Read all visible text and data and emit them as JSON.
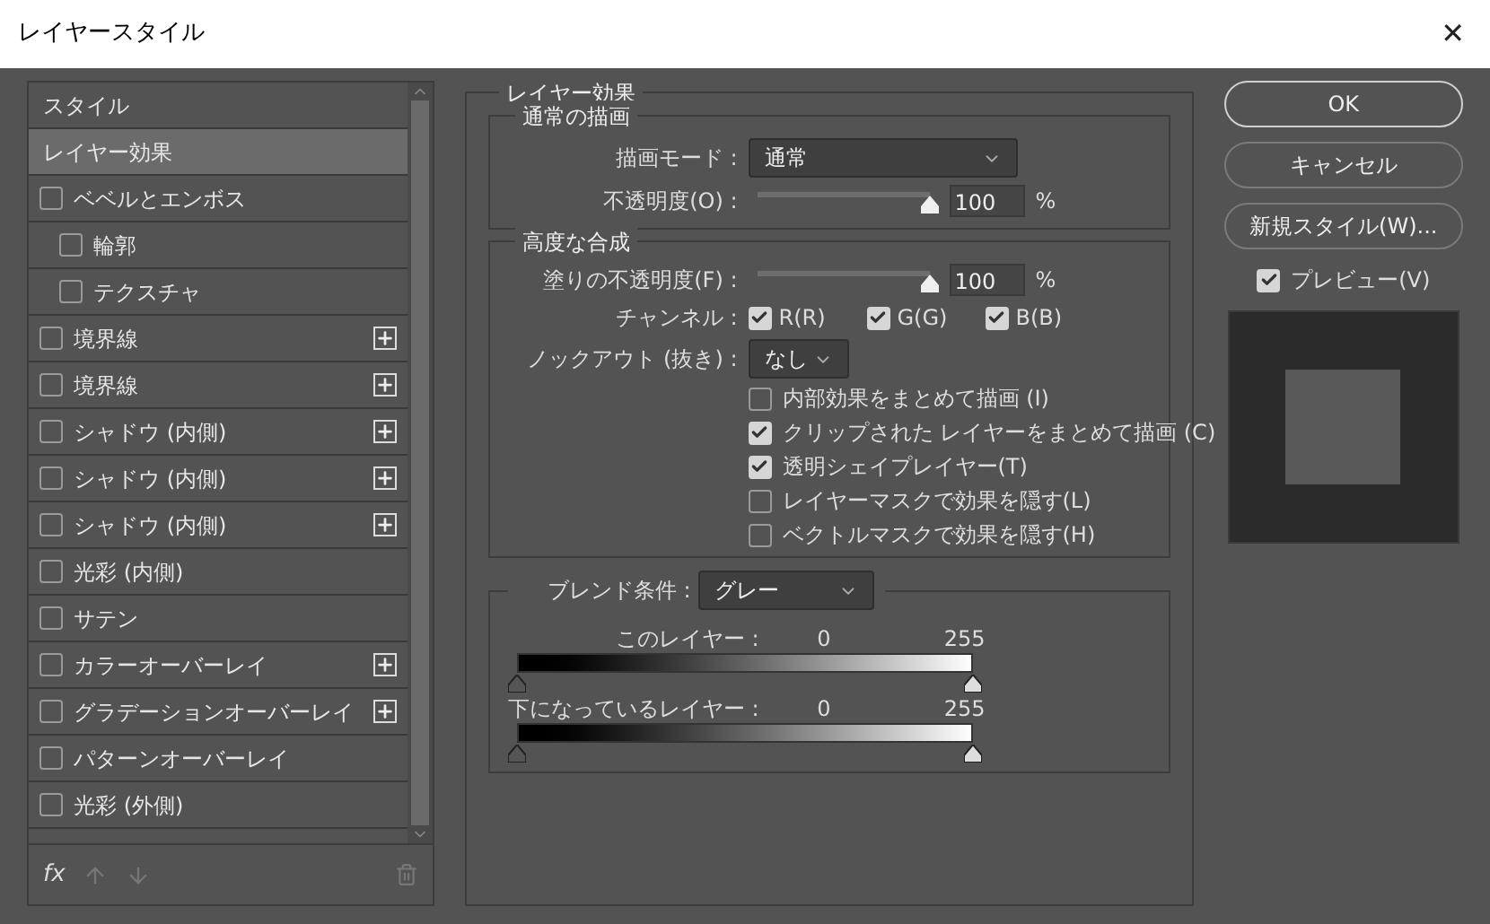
{
  "window": {
    "title": "レイヤースタイル",
    "close": "✕"
  },
  "sidebar": {
    "items": [
      {
        "label": "スタイル",
        "kind": "header",
        "selected": false
      },
      {
        "label": "レイヤー効果",
        "kind": "header",
        "selected": true
      },
      {
        "label": "ベベルとエンボス",
        "kind": "effect",
        "checked": false,
        "plus": false,
        "children": [
          {
            "label": "輪郭",
            "kind": "effect",
            "checked": false,
            "plus": false
          },
          {
            "label": "テクスチャ",
            "kind": "effect",
            "checked": false,
            "plus": false
          }
        ]
      },
      {
        "label": "境界線",
        "kind": "effect",
        "checked": false,
        "plus": true
      },
      {
        "label": "境界線",
        "kind": "effect",
        "checked": false,
        "plus": true
      },
      {
        "label": "シャドウ (内側)",
        "kind": "effect",
        "checked": false,
        "plus": true
      },
      {
        "label": "シャドウ (内側)",
        "kind": "effect",
        "checked": false,
        "plus": true
      },
      {
        "label": "シャドウ (内側)",
        "kind": "effect",
        "checked": false,
        "plus": true
      },
      {
        "label": "光彩 (内側)",
        "kind": "effect",
        "checked": false,
        "plus": false
      },
      {
        "label": "サテン",
        "kind": "effect",
        "checked": false,
        "plus": false
      },
      {
        "label": "カラーオーバーレイ",
        "kind": "effect",
        "checked": false,
        "plus": true
      },
      {
        "label": "グラデーションオーバーレイ",
        "kind": "effect",
        "checked": false,
        "plus": true
      },
      {
        "label": "パターンオーバーレイ",
        "kind": "effect",
        "checked": false,
        "plus": false
      },
      {
        "label": "光彩 (外側)",
        "kind": "effect",
        "checked": false,
        "plus": false
      }
    ],
    "fx": "fx"
  },
  "panel": {
    "title": "レイヤー効果",
    "normal": {
      "title": "通常の描画",
      "mode_label": "描画モード :",
      "mode": "通常",
      "opacity_label": "不透明度(O) :",
      "opacity": {
        "level": 1
      },
      "opacity_value": "100",
      "unit": "%"
    },
    "advanced": {
      "title": "高度な合成",
      "fill_label": "塗りの不透明度(F) :",
      "fill": {
        "level": 1
      },
      "fill_value": "100",
      "unit": "%",
      "channels_label": "チャンネル :",
      "channels": [
        {
          "label": "R(R)",
          "checked": true
        },
        {
          "label": "G(G)",
          "checked": true
        },
        {
          "label": "B(B)",
          "checked": true
        }
      ],
      "knockout_label": "ノックアウト (抜き) :",
      "knockout": "なし",
      "options": [
        {
          "label": "内部効果をまとめて描画 (I)",
          "checked": false
        },
        {
          "label": "クリップされた レイヤーをまとめて描画 (C)",
          "checked": true
        },
        {
          "label": "透明シェイプレイヤー(T)",
          "checked": true
        },
        {
          "label": "レイヤーマスクで効果を隠す(L)",
          "checked": false
        },
        {
          "label": "ベクトルマスクで効果を隠す(H)",
          "checked": false
        }
      ]
    },
    "blend": {
      "label": "ブレンド条件 :",
      "value": "グレー",
      "ranges": [
        {
          "label": "このレイヤー :",
          "low": "0",
          "high": "255",
          "thumbs": [
            {
              "level": 0
            },
            {
              "level": 1
            }
          ]
        },
        {
          "label": "下になっているレイヤー :",
          "low": "0",
          "high": "255",
          "thumbs": [
            {
              "level": 0
            },
            {
              "level": 1
            }
          ]
        }
      ]
    }
  },
  "buttons": [
    {
      "label": "OK",
      "default": true
    },
    {
      "label": "キャンセル",
      "default": false
    },
    {
      "label": "新規スタイル(W)...",
      "default": false
    }
  ],
  "preview": {
    "label": "プレビュー(V)",
    "checked": true
  }
}
